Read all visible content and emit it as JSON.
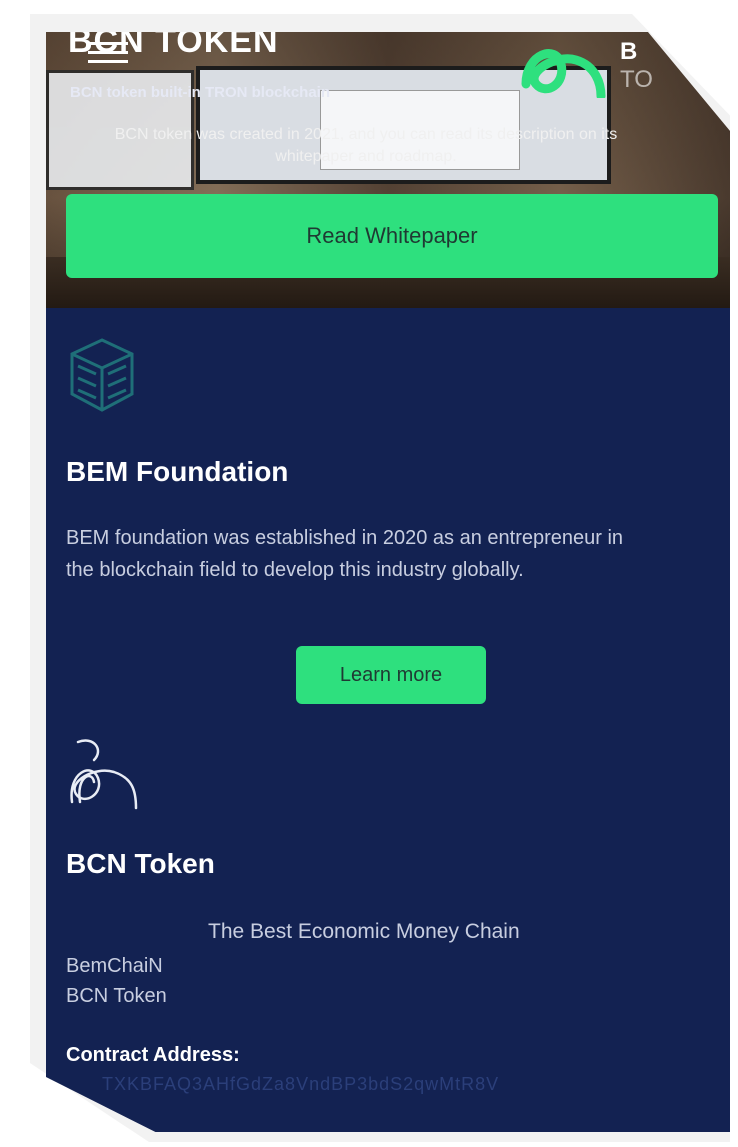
{
  "hero": {
    "title": "BCN TOKEN",
    "subtitle": "BCN token built-in TRON blockchain",
    "description": "BCN token was created in 2021, and you can read its description on its whitepaper and roadmap.",
    "brand_line1": "B",
    "brand_line2": "TO",
    "whitepaper_label": "Read Whitepaper"
  },
  "foundation": {
    "heading": "BEM Foundation",
    "text": "BEM foundation was established in 2020 as an entrepreneur in the blockchain field to develop this industry globally.",
    "button_label": "Learn more"
  },
  "token": {
    "heading": "BCN Token",
    "tagline": "The Best Economic Money Chain",
    "line1": "BemChaiN",
    "line2": "BCN Token",
    "contract_label": "Contract Address:",
    "contract_address": "TXKBFAQ3AHfGdZa8VndBP3bdS2qwMtR8V"
  },
  "colors": {
    "accent": "#2ee07e",
    "background": "#132252",
    "icon_teal": "#1f6f78"
  },
  "icons": [
    "menu-icon",
    "bcn-logo-icon",
    "cube-icon"
  ]
}
